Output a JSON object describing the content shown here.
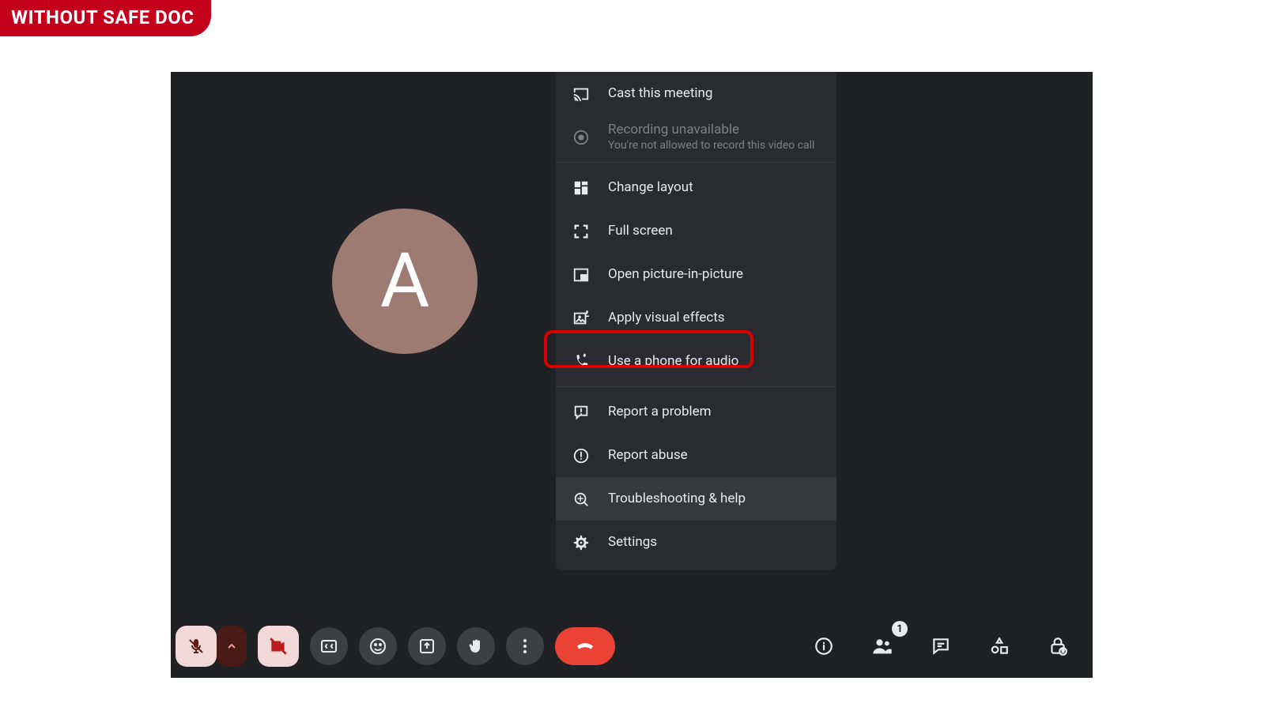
{
  "badge": {
    "label": "WITHOUT SAFE DOC"
  },
  "avatar": {
    "letter": "A"
  },
  "menu": {
    "items": [
      {
        "id": "cast",
        "label": "Cast this meeting",
        "icon": "cast-icon",
        "disabled": false
      },
      {
        "id": "recording",
        "label": "Recording unavailable",
        "sub": "You're not allowed to record this video call",
        "icon": "record-icon",
        "disabled": true
      },
      {
        "id": "layout",
        "label": "Change layout",
        "icon": "layout-icon",
        "disabled": false
      },
      {
        "id": "fullscreen",
        "label": "Full screen",
        "icon": "fullscreen-icon",
        "disabled": false
      },
      {
        "id": "pip",
        "label": "Open picture-in-picture",
        "icon": "pip-icon",
        "disabled": false
      },
      {
        "id": "effects",
        "label": "Apply visual effects",
        "icon": "effects-icon",
        "disabled": false,
        "highlighted": true
      },
      {
        "id": "phone",
        "label": "Use a phone for audio",
        "icon": "phone-audio-icon",
        "disabled": false
      },
      {
        "id": "report",
        "label": "Report a problem",
        "icon": "feedback-icon",
        "disabled": false
      },
      {
        "id": "abuse",
        "label": "Report abuse",
        "icon": "abuse-icon",
        "disabled": false
      },
      {
        "id": "help",
        "label": "Troubleshooting & help",
        "icon": "help-icon",
        "disabled": false,
        "hover": true
      },
      {
        "id": "settings",
        "label": "Settings",
        "icon": "gear-icon",
        "disabled": false
      }
    ],
    "dividers_after": [
      "recording",
      "phone"
    ]
  },
  "toolbar": {
    "left": [
      {
        "id": "mic",
        "icon": "mic-off-icon",
        "style": "light square"
      },
      {
        "id": "mic-up",
        "icon": "chevron-up-icon",
        "style": "darkred square"
      },
      {
        "id": "cam",
        "icon": "cam-off-icon",
        "style": "light square"
      },
      {
        "id": "cc",
        "icon": "captions-icon",
        "style": ""
      },
      {
        "id": "emoji",
        "icon": "emoji-icon",
        "style": ""
      },
      {
        "id": "present",
        "icon": "present-icon",
        "style": ""
      },
      {
        "id": "hand",
        "icon": "hand-icon",
        "style": ""
      },
      {
        "id": "more",
        "icon": "more-vert-icon",
        "style": ""
      },
      {
        "id": "hangup",
        "icon": "hangup-icon",
        "style": "hangup"
      }
    ],
    "right": [
      {
        "id": "info",
        "icon": "info-icon"
      },
      {
        "id": "people",
        "icon": "people-icon",
        "badge": "1"
      },
      {
        "id": "chat",
        "icon": "chat-icon"
      },
      {
        "id": "activities",
        "icon": "activities-icon"
      },
      {
        "id": "lock",
        "icon": "lock-icon"
      }
    ]
  }
}
